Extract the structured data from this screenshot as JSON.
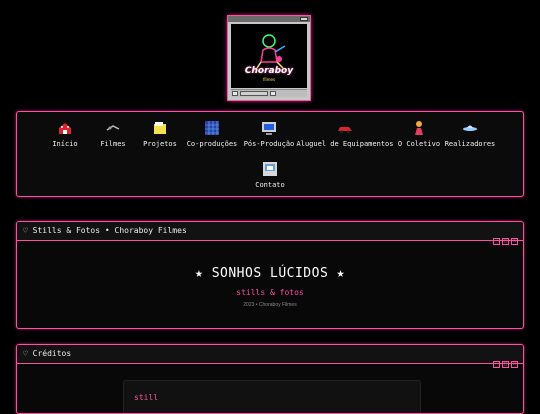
{
  "player": {
    "logo_text": "Choraboy",
    "logo_sub": "filmes"
  },
  "nav": {
    "items": [
      {
        "label": "Início",
        "icon": "house-icon"
      },
      {
        "label": "Filmes",
        "icon": "film-icon"
      },
      {
        "label": "Projetos",
        "icon": "folder-icon"
      },
      {
        "label": "Co-produções",
        "icon": "network-icon"
      },
      {
        "label": "Pós-Produção",
        "icon": "monitor-icon"
      },
      {
        "label": "Aluguel de Equipamentos",
        "icon": "car-icon"
      },
      {
        "label": "O Coletivo",
        "icon": "people-icon"
      },
      {
        "label": "Realizadores",
        "icon": "ufo-icon"
      },
      {
        "label": "Contato",
        "icon": "computer-mail-icon"
      }
    ]
  },
  "stills_window": {
    "title": "♡ Stills & Fotos • Choraboy Filmes",
    "heading": "★ SONHOS LÚCIDOS ★",
    "subheading": "stills & fotos",
    "meta": "2023 • Choraboy Filmes"
  },
  "credits_window": {
    "title": "♡ Créditos",
    "card_label": "still"
  },
  "colors": {
    "accent": "#ff4fa3",
    "background": "#000000"
  }
}
